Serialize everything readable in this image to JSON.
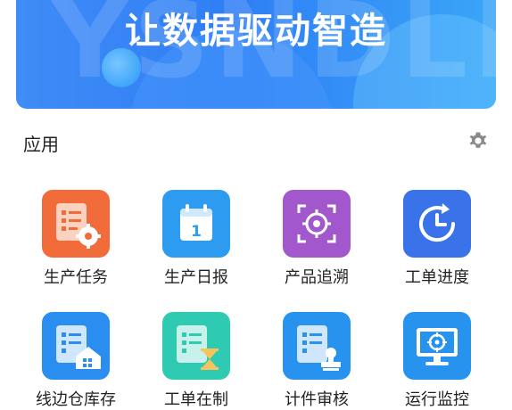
{
  "banner": {
    "watermark": "YSNDLE",
    "slogan": "让数据驱动智造"
  },
  "section": {
    "title": "应用",
    "settings_icon": "gear-icon"
  },
  "apps": [
    {
      "label": "生产任务",
      "icon": "doc-gear-icon",
      "color": "#f26b3a"
    },
    {
      "label": "生产日报",
      "icon": "calendar-icon",
      "color": "#2c9bf0"
    },
    {
      "label": "产品追溯",
      "icon": "target-scan-icon",
      "color": "#a257cc"
    },
    {
      "label": "工单进度",
      "icon": "clock-refresh-icon",
      "color": "#3a72e9"
    },
    {
      "label": "线边仓库存",
      "icon": "doc-warehouse-icon",
      "color": "#2a8ef0"
    },
    {
      "label": "工单在制",
      "icon": "doc-hourglass-icon",
      "color": "#2ecbb2"
    },
    {
      "label": "计件审核",
      "icon": "doc-stamp-icon",
      "color": "#2893ef"
    },
    {
      "label": "运行监控",
      "icon": "monitor-target-icon",
      "color": "#2893ef"
    }
  ]
}
